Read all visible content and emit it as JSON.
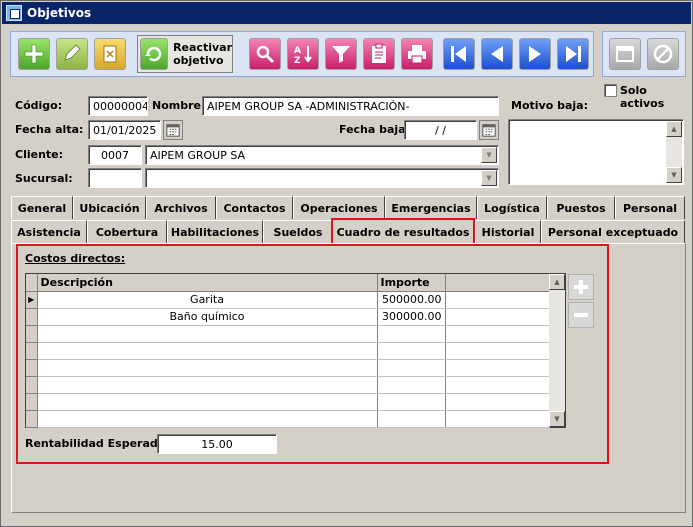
{
  "window": {
    "title": "Objetivos"
  },
  "toolbar": {
    "reactivar_line1": "Reactivar",
    "reactivar_line2": "objetivo",
    "buttons": [
      "add-icon",
      "edit-icon",
      "delete-icon",
      "reactivate-icon",
      "search-icon",
      "sort-az-icon",
      "filter-icon",
      "clipboard-icon",
      "print-icon",
      "first-record-icon",
      "previous-record-icon",
      "next-record-icon",
      "last-record-icon",
      "window-icon",
      "cancel-icon"
    ]
  },
  "form": {
    "codigo_label": "Código:",
    "codigo_value": "00000004",
    "nombre_label": "Nombre:",
    "nombre_value": "AIPEM GROUP SA -ADMINISTRACIÓN-",
    "motivo_label": "Motivo baja:",
    "solo_activos_label": "Solo activos",
    "fecha_alta_label": "Fecha alta:",
    "fecha_alta_value": "01/01/2025",
    "fecha_baja_label": "Fecha baja:",
    "fecha_baja_value": "/ /",
    "cliente_label": "Cliente:",
    "cliente_code": "0007",
    "cliente_name": "AIPEM GROUP SA",
    "sucursal_label": "Sucursal:",
    "sucursal_code": "",
    "sucursal_name": ""
  },
  "tabs_row1": [
    "General",
    "Ubicación",
    "Archivos",
    "Contactos",
    "Operaciones",
    "Emergencias",
    "Logística",
    "Puestos",
    "Personal"
  ],
  "tabs_row2": [
    "Asistencia",
    "Cobertura",
    "Habilitaciones",
    "Sueldos",
    "Cuadro de resultados",
    "Historial",
    "Personal exceptuado"
  ],
  "panel": {
    "section_title": "Costos directos:",
    "col_descripcion": "Descripción",
    "col_importe": "Importe",
    "rows": [
      {
        "descripcion": "Garita",
        "importe": "500000.00"
      },
      {
        "descripcion": "Baño químico",
        "importe": "300000.00"
      }
    ],
    "rentabilidad_label": "Rentabilidad Esperada:",
    "rentabilidad_value": "15.00"
  },
  "colors": {
    "title_bar": "#0a246a",
    "highlight": "#e0141e",
    "window_bg": "#d4d0c8"
  }
}
